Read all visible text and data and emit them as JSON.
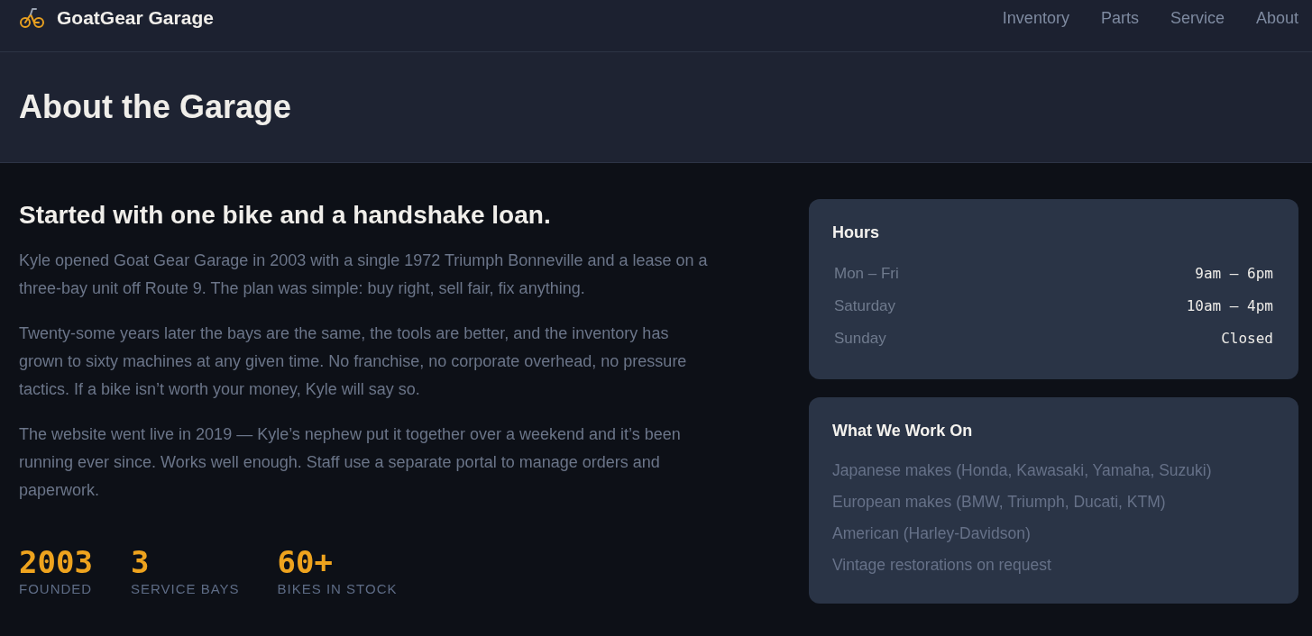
{
  "header": {
    "brand": "GoatGear Garage",
    "nav": [
      "Inventory",
      "Parts",
      "Service",
      "About"
    ]
  },
  "hero": {
    "title": "About the Garage"
  },
  "story": {
    "heading": "Started with one bike and a handshake loan.",
    "paragraphs": [
      "Kyle opened Goat Gear Garage in 2003 with a single 1972 Triumph Bonneville and a lease on a three-bay unit off Route 9. The plan was simple: buy right, sell fair, fix anything.",
      "Twenty-some years later the bays are the same, the tools are better, and the inventory has grown to sixty machines at any given time. No franchise, no corporate overhead, no pressure tactics. If a bike isn’t worth your money, Kyle will say so.",
      "The website went live in 2019 — Kyle’s nephew put it together over a weekend and it’s been running ever since. Works well enough. Staff use a separate portal to manage orders and paperwork."
    ]
  },
  "stats": [
    {
      "value": "2003",
      "label": "FOUNDED"
    },
    {
      "value": "3",
      "label": "SERVICE BAYS"
    },
    {
      "value": "60+",
      "label": "BIKES IN STOCK"
    }
  ],
  "hours": {
    "title": "Hours",
    "rows": [
      {
        "day": "Mon – Fri",
        "time": "9am – 6pm"
      },
      {
        "day": "Saturday",
        "time": "10am – 4pm"
      },
      {
        "day": "Sunday",
        "time": "Closed"
      }
    ]
  },
  "work": {
    "title": "What We Work On",
    "items": [
      "Japanese makes (Honda, Kawasaki, Yamaha, Suzuki)",
      "European makes (BMW, Triumph, Ducati, KTM)",
      "American (Harley-Davidson)",
      "Vintage restorations on request"
    ]
  }
}
